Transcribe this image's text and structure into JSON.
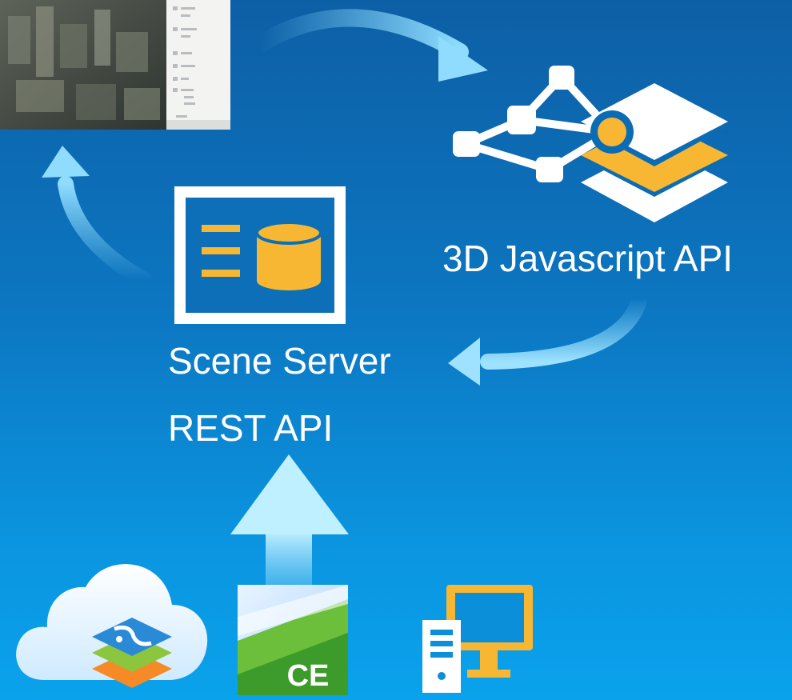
{
  "labels": {
    "js_api": "3D Javascript API",
    "scene_server": "Scene Server",
    "rest_api": "REST API"
  },
  "icons": {
    "thumbnail": "city-scene-thumbnail-icon",
    "js_api": "layers-network-icon",
    "scene_server": "scene-server-service-icon",
    "cloud": "cloud-layers-icon",
    "cityengine": "cityengine-app-icon",
    "desktop": "desktop-computer-icon"
  },
  "cityengine_badge": "CE",
  "colors": {
    "background_top": "#0d5fa5",
    "background_bottom": "#0aa2ec",
    "accent_yellow": "#f7b733",
    "arrow": "#7fd3f5",
    "white": "#ffffff"
  }
}
